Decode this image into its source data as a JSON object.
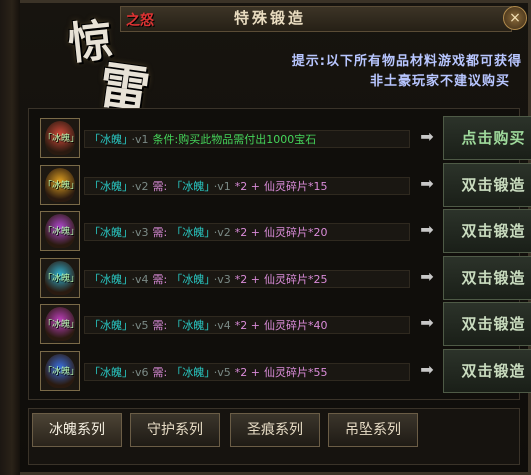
{
  "window": {
    "title": "特殊锻造",
    "close_label": "×",
    "logo_main_1": "惊",
    "logo_main_2": "雷",
    "logo_small": "之怒"
  },
  "notice": {
    "line1": "提示:以下所有物品材料游戏都可获得",
    "line2": "非土豪玩家不建议购买"
  },
  "rows": [
    {
      "item_name": "「冰魄」",
      "item_level": "·v1",
      "req_prefix": "条件:购买此物品需付出1000宝石",
      "req_item": "",
      "req_level": "",
      "req_qty": "",
      "req_mat": "",
      "action": "点击购买",
      "glow": "#d24a3a"
    },
    {
      "item_name": "「冰魄」",
      "item_level": "·v2",
      "req_prefix": "需:",
      "req_item": "「冰魄」",
      "req_level": "·v1",
      "req_qty": "*2 +",
      "req_mat": "仙灵碎片*15",
      "action": "双击锻造",
      "glow": "#e0a020"
    },
    {
      "item_name": "「冰魄」",
      "item_level": "·v3",
      "req_prefix": "需:",
      "req_item": "「冰魄」",
      "req_level": "·v2",
      "req_qty": "*2 +",
      "req_mat": "仙灵碎片*20",
      "action": "双击锻造",
      "glow": "#b04ad0"
    },
    {
      "item_name": "「冰魄」",
      "item_level": "·v4",
      "req_prefix": "需:",
      "req_item": "「冰魄」",
      "req_level": "·v3",
      "req_qty": "*2 +",
      "req_mat": "仙灵碎片*25",
      "action": "双击锻造",
      "glow": "#2fb0d0"
    },
    {
      "item_name": "「冰魄」",
      "item_level": "·v5",
      "req_prefix": "需:",
      "req_item": "「冰魄」",
      "req_level": "·v4",
      "req_qty": "*2 +",
      "req_mat": "仙灵碎片*40",
      "action": "双击锻造",
      "glow": "#c040c0"
    },
    {
      "item_name": "「冰魄」",
      "item_level": "·v6",
      "req_prefix": "需:",
      "req_item": "「冰魄」",
      "req_level": "·v5",
      "req_qty": "*2 +",
      "req_mat": "仙灵碎片*55",
      "action": "双击锻造",
      "glow": "#3a70e0"
    }
  ],
  "tabs": [
    {
      "label": "冰魄系列"
    },
    {
      "label": "守护系列"
    },
    {
      "label": "圣痕系列"
    },
    {
      "label": "吊坠系列"
    }
  ]
}
